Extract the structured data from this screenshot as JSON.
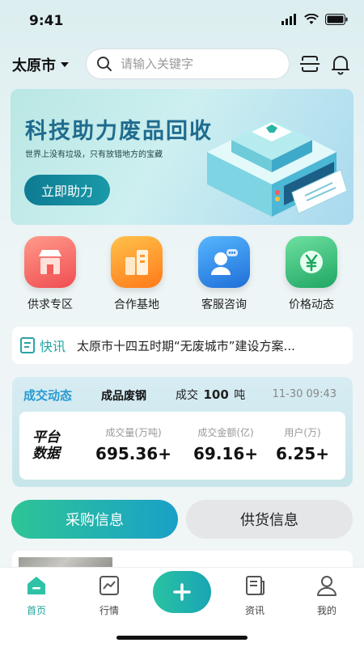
{
  "status": {
    "time": "9:41"
  },
  "header": {
    "city": "太原市",
    "search_placeholder": "请输入关键字"
  },
  "banner": {
    "title": "科技助力废品回收",
    "subtitle": "世界上没有垃圾，只有放错地方的宝藏",
    "button": "立即助力"
  },
  "quick_actions": [
    {
      "label": "供求专区",
      "icon": "shop-icon",
      "color": "#ff6f61"
    },
    {
      "label": "合作基地",
      "icon": "building-icon",
      "color": "#ff8a1f"
    },
    {
      "label": "客服咨询",
      "icon": "support-icon",
      "color": "#2e8fe8"
    },
    {
      "label": "价格动态",
      "icon": "yen-icon",
      "color": "#2bb873"
    }
  ],
  "news": {
    "tag": "快讯",
    "text": "太原市十四五时期“无废城市”建设方案..."
  },
  "deal": {
    "title": "成交动态",
    "product": "成品废钢",
    "volume_prefix": "成交",
    "volume_value": "100",
    "volume_unit": "吨",
    "time": "11-30 09:43",
    "logo_line1": "平台",
    "logo_line2": "数据",
    "stats": [
      {
        "label": "成交量(万吨)",
        "value": "695.36+"
      },
      {
        "label": "成交金额(亿)",
        "value": "69.16+"
      },
      {
        "label": "用户(万)",
        "value": "6.25+"
      }
    ]
  },
  "tabs": {
    "buy": "采购信息",
    "supply": "供货信息"
  },
  "list_peek": {
    "text": "..."
  },
  "tabbar": [
    {
      "label": "首页",
      "icon": "home-icon",
      "active": true
    },
    {
      "label": "行情",
      "icon": "chart-icon",
      "active": false
    },
    {
      "label": "资讯",
      "icon": "news-icon",
      "active": false
    },
    {
      "label": "我的",
      "icon": "user-icon",
      "active": false
    }
  ],
  "colors": {
    "accent": "#23a39c",
    "brand_blue": "#1f6b8e"
  }
}
